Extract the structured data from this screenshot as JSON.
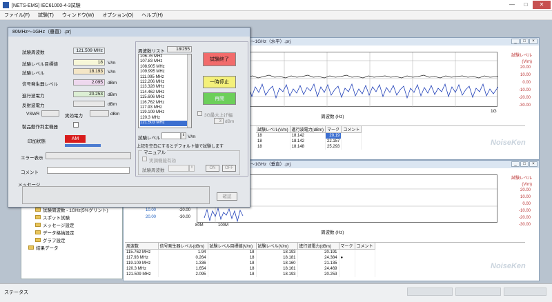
{
  "window": {
    "title": "[NETS-EMS] IEC61000-4-3試験",
    "minimize": "—",
    "maximize": "□",
    "close": "✕"
  },
  "menu": [
    "ファイル(F)",
    "試験(T)",
    "ウィンドウ(W)",
    "オプション(O)",
    "ヘルプ(H)"
  ],
  "status": {
    "text": "ステータス"
  },
  "dialog": {
    "title": "80MHz～1GHz（垂直）.prj",
    "freq_label": "試験周波数",
    "freq_value": "121.509 MHz",
    "target_label": "試験レベル目標値",
    "target_value": "18",
    "target_unit": "V/m",
    "level_label": "試験レベル",
    "level_value": "18.193",
    "level_unit": "V/m",
    "siggen_label": "信号発生器レベル",
    "siggen_value": "2.095",
    "siggen_unit": "dBm",
    "fwd_label": "進行波電力",
    "fwd_value": "20.253",
    "fwd_unit": "dBm",
    "rev_label": "反射波電力",
    "rev_value": "",
    "rev_unit": "dBm",
    "vswr_label": "VSWR",
    "actual_label": "実効電力",
    "actual_unit": "dBm",
    "dut_label": "製品動作判定機器",
    "mod_label": "印加状態",
    "mod_value": "AM",
    "error_label": "エラー表示",
    "comment_label": "コメント",
    "message_label": "メッセージ",
    "confirm_label": "確認",
    "freqlist_label": "周波数リスト",
    "freqlist_count": "18/255",
    "freqlist": [
      "106.76 MHz",
      "107.83 MHz",
      "108.905 MHz",
      "109.995 MHz",
      "111.095 MHz",
      "112.206 MHz",
      "113.328 MHz",
      "114.462 MHz",
      "115.606 MHz",
      "116.762 MHz",
      "117.93 MHz",
      "119.109 MHz",
      "120.3 MHz",
      "121.503 MHz"
    ],
    "stop_button": "試験終了",
    "pause_button": "一時停止",
    "resume_button": "再開",
    "auto_step_label": "3G最大上げ幅",
    "auto_step_value": "3",
    "auto_step_unit": "dBm",
    "testlevel_label": "試験レベル",
    "testlevel_unit": "V/m",
    "note": "上記を空白にするとデフォルト値で試験します",
    "manual_label": "マニュアル",
    "manual_check": "実調機能有効",
    "manual_freq_label": "試験周波数",
    "on_button": "ON",
    "off_button": "OFF"
  },
  "tree": {
    "items": [
      "試験周波数 - 1GHz(5%グリント)",
      "スポット試験",
      "メッセージ設定",
      "データ格納設定",
      "グラフ設定",
      "結果データ"
    ]
  },
  "top_window": {
    "title": "～1GHz（水平）.prj",
    "yaxis_title": "試験レベル (V/m)",
    "yticks": [
      "30.00",
      "20.00",
      "10.00",
      "0.00",
      "-10.00",
      "-20.00",
      "-30.00"
    ],
    "xaxis_title": "周波数 (Hz)",
    "x_end": "1G",
    "columns": [
      "試験レベル(V/m)",
      "進行波電力(dBm)",
      "マーク",
      "コメント"
    ],
    "rows": [
      {
        "target": "18",
        "level": "18.142",
        "power": "20.19"
      },
      {
        "target": "18",
        "level": "18.142",
        "power": "22.157"
      },
      {
        "target": "18",
        "level": "18.148",
        "power": "25.293"
      }
    ],
    "logo": "NoiseKen"
  },
  "bottom_window": {
    "title": "～1GHz（垂直）.prj",
    "yaxis_title": "試験レベル (V/m)",
    "yticks": [
      "30.00",
      "20.00",
      "10.00",
      "0.00",
      "-10.00",
      "-20.00",
      "-30.00"
    ],
    "left_ticks": [
      {
        "blue": "10.00",
        "black": "-20.00"
      },
      {
        "blue": "20.00",
        "black": "-30.00"
      }
    ],
    "x_ticks": [
      "80M",
      "100M"
    ],
    "xaxis_title": "周波数 (Hz)",
    "columns": [
      "周波数",
      "信号発生器レベル(dBm)",
      "試験レベル目標値(V/m)",
      "試験レベル(V/m)",
      "進行波電力(dBm)",
      "マーク",
      "コメント"
    ],
    "rows": [
      {
        "freq": "115.762 MHz",
        "sg": "1.94",
        "target": "18",
        "level": "18.193",
        "power": "20.191"
      },
      {
        "freq": "117.93 MHz",
        "sg": "0.264",
        "target": "18",
        "level": "18.181",
        "power": "24.384"
      },
      {
        "freq": "119.109 MHz",
        "sg": "1.336",
        "target": "18",
        "level": "18.160",
        "power": "21.135"
      },
      {
        "freq": "120.3 MHz",
        "sg": "1.654",
        "target": "18",
        "level": "18.161",
        "power": "24.469"
      },
      {
        "freq": "121.509 MHz",
        "sg": "2.095",
        "target": "18",
        "level": "18.193",
        "power": "20.253"
      }
    ],
    "logo": "NoiseKen"
  },
  "colors": {
    "stop": "#f26b6b",
    "pause": "#f4f07a",
    "resume": "#6ccf5a",
    "am": "#d81c1c",
    "blue_trace": "#1f3fb8"
  }
}
